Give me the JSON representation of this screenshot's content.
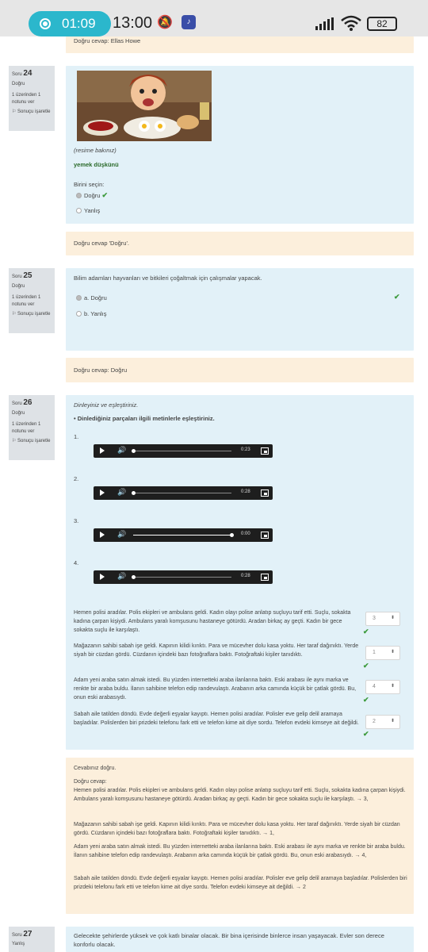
{
  "status_bar": {
    "recording_time": "01:09",
    "clock": "13:00",
    "battery": "82",
    "icons": [
      "record-icon",
      "mute-icon",
      "app-icon",
      "signal-icon",
      "wifi-icon",
      "battery-icon"
    ]
  },
  "top_feedback": {
    "text": "Doğru cevap: Ellas Howe"
  },
  "q24": {
    "label": "Soru",
    "number": "24",
    "state": "Doğru",
    "mark": "1 üzerinden 1 notunu ver",
    "flag": "Sonuçu işaretle",
    "image_caption": "(resime bakınız)",
    "prompt": "yemek düşkünü",
    "select_label": "Birini seçin:",
    "options": [
      "Doğru",
      "Yanlış"
    ],
    "feedback": "Doğru cevap 'Doğru'."
  },
  "q25": {
    "label": "Soru",
    "number": "25",
    "state": "Doğru",
    "mark": "1 üzerinden 1 notunu ver",
    "flag": "Sonuçu işaretle",
    "prompt": "Bilim adamları hayvanları ve bitkileri çoğaltmak için çalışmalar yapacak.",
    "options": [
      "a. Doğru",
      "b. Yanlış"
    ],
    "feedback": "Doğru cevap: Doğru"
  },
  "q26": {
    "label": "Soru",
    "number": "26",
    "state": "Doğru",
    "mark": "1 üzerinden 1 notunu ver",
    "flag": "Sonuçu işaretle",
    "instruction": "Dinleyiniz ve eşleştiriniz.",
    "bullet": "Dinlediğiniz parçaları ilgili metinlerle eşleştiriniz.",
    "audios": [
      {
        "index": "1.",
        "time": "0:23",
        "progress": 0
      },
      {
        "index": "2.",
        "time": "0:28",
        "progress": 0
      },
      {
        "index": "3.",
        "time": "0:00",
        "progress": 1
      },
      {
        "index": "4.",
        "time": "0:28",
        "progress": 0
      }
    ],
    "items": [
      {
        "text": "Hemen polisi aradılar. Polis ekipleri ve ambulans geldi. Kadın olayı polise anlatıp suçluyu tarif etti. Suçlu, sokakta kadına çarpan kişiydi. Ambulans yaralı komşusunu hastaneye götürdü. Aradan birkaç ay geçti. Kadın bir gece sokakta suçlu ile karşılaştı.",
        "answer": "3"
      },
      {
        "text": "Mağazanın sahibi sabah işe geldi. Kapının kilidi kırıktı. Para ve mücevher dolu kasa yoktu. Her taraf dağınıktı. Yerde siyah bir cüzdan gördü. Cüzdanın içindeki bazı fotoğraflara baktı. Fotoğraftaki kişiler tanıdıktı.",
        "answer": "1"
      },
      {
        "text": "Adam yeni araba satın almak istedi. Bu yüzden internetteki araba ilanlarına baktı. Eski arabası ile aynı marka ve renkte bir araba buldu. İlanın sahibine telefon edip randevulaştı. Arabanın arka camında küçük bir çatlak gördü. Bu, onun eski arabasıydı.",
        "answer": "4"
      },
      {
        "text": "Sabah aile tatilden döndü. Evde değerli eşyalar kayıptı. Hemen polisi aradılar. Polisler eve gelip delil aramaya başladılar. Polislerden biri prizdeki telefonu fark etti ve telefon kime ait diye sordu. Telefon evdeki kimseye ait değildi.",
        "answer": "2"
      }
    ],
    "feedback_title": "Cevabınız doğru.",
    "feedback_label": "Doğru cevap:",
    "feedback_items": [
      "Hemen polisi aradılar. Polis ekipleri ve ambulans geldi. Kadın olayı polise anlatıp suçluyu tarif etti. Suçlu, sokakta kadına çarpan kişiydi. Ambulans yaralı komşusunu hastaneye götürdü. Aradan birkaç ay geçti. Kadın bir gece sokakta suçlu ile karşılaştı. → 3,",
      "Mağazanın sahibi sabah işe geldi. Kapının kilidi kırıktı. Para ve mücevher dolu kasa yoktu. Her taraf dağınıktı. Yerde siyah bir cüzdan gördü. Cüzdanın içindeki bazı fotoğraflara baktı. Fotoğraftaki kişiler tanıdıktı. → 1,",
      "Adam yeni araba satın almak istedi. Bu yüzden internetteki araba ilanlarına baktı. Eski arabası ile aynı marka ve renkte bir araba buldu. İlanın sahibine telefon edip randevulaştı. Arabanın arka camında küçük bir çatlak gördü. Bu, onun eski arabasıydı. → 4,",
      "Sabah aile tatilden döndü. Evde değerli eşyalar kayıptı. Hemen polisi aradılar. Polisler eve gelip delil aramaya başladılar. Polislerden biri prizdeki telefonu fark etti ve telefon kime ait diye sordu. Telefon evdeki kimseye ait değildi. → 2"
    ]
  },
  "q27": {
    "label": "Soru",
    "number": "27",
    "state": "Yanlış",
    "prompt": "Gelecekte şehirlerde yüksek ve çok katlı binalar olacak. Bir bina içerisinde binlerce insan yaşayacak. Evler son derece konforlu olacak."
  },
  "colors": {
    "content_bg": "#e2f1f8",
    "feedback_bg": "#fcefdc",
    "info_bg": "#dee2e6",
    "correct": "#3c9a3c",
    "rec_pill": "#2bb7cc"
  }
}
